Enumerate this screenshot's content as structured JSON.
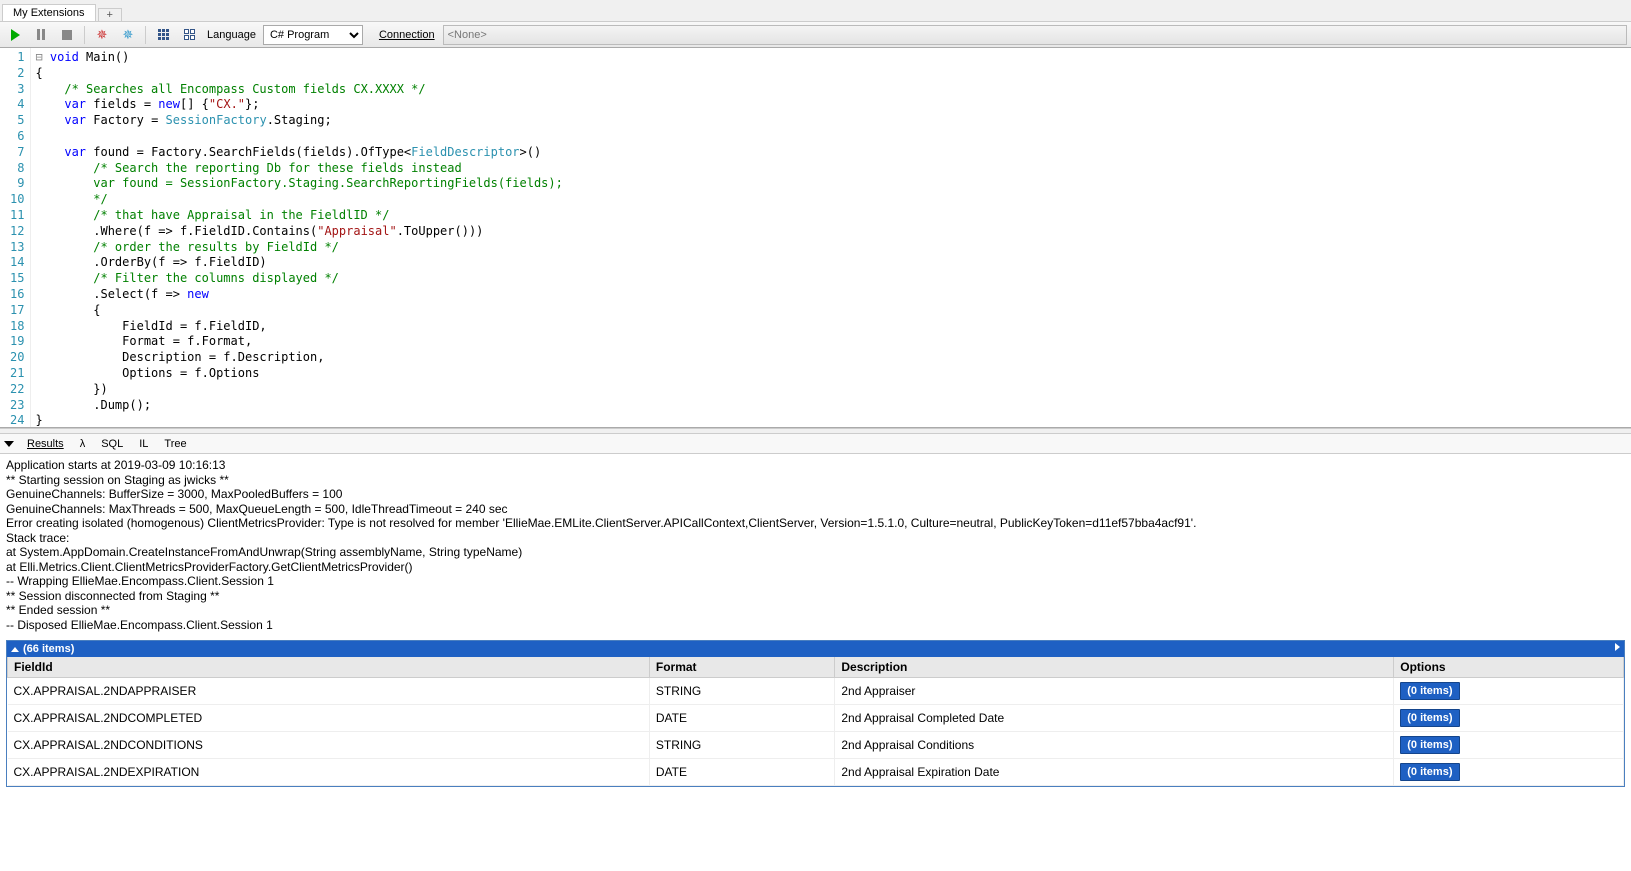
{
  "tabs": {
    "main": "My Extensions",
    "add": "+"
  },
  "toolbar": {
    "language_label": "Language",
    "language_value": "C# Program",
    "connection_label": "Connection",
    "connection_value": "<None>"
  },
  "code": {
    "lines": [
      "1",
      "2",
      "3",
      "4",
      "5",
      "6",
      "7",
      "8",
      "9",
      "10",
      "11",
      "12",
      "13",
      "14",
      "15",
      "16",
      "17",
      "18",
      "19",
      "20",
      "21",
      "22",
      "23",
      "24"
    ],
    "l1a": "void",
    "l1b": " Main()",
    "l2": "{",
    "l3a": "    ",
    "l3b": "/* Searches all Encompass Custom fields CX.XXXX */",
    "l4a": "    ",
    "l4b": "var",
    "l4c": " fields = ",
    "l4d": "new",
    "l4e": "[] {",
    "l4f": "\"CX.\"",
    "l4g": "};",
    "l5a": "    ",
    "l5b": "var",
    "l5c": " Factory = ",
    "l5d": "SessionFactory",
    "l5e": ".Staging;",
    "l6": "",
    "l7a": "    ",
    "l7b": "var",
    "l7c": " found = Factory.SearchFields(fields).OfType<",
    "l7d": "FieldDescriptor",
    "l7e": ">()",
    "l8a": "        ",
    "l8b": "/* Search the reporting Db for these fields instead",
    "l9": "        var found = SessionFactory.Staging.SearchReportingFields(fields);",
    "l10": "        */",
    "l11a": "        ",
    "l11b": "/* that have Appraisal in the FieldlID */",
    "l12a": "        .Where(f => f.FieldID.Contains(",
    "l12b": "\"Appraisal\"",
    "l12c": ".ToUpper()))",
    "l13a": "        ",
    "l13b": "/* order the results by FieldId */",
    "l14": "        .OrderBy(f => f.FieldID)",
    "l15a": "        ",
    "l15b": "/* Filter the columns displayed */",
    "l16a": "        .Select(f => ",
    "l16b": "new",
    "l17": "        {",
    "l18": "            FieldId = f.FieldID,",
    "l19": "            Format = f.Format,",
    "l20": "            Description = f.Description,",
    "l21": "            Options = f.Options",
    "l22": "        })",
    "l23": "        .Dump();",
    "l24": "}"
  },
  "result_tabs": {
    "results": "Results",
    "lambda": "λ",
    "sql": "SQL",
    "il": "IL",
    "tree": "Tree"
  },
  "output_lines": [
    "Application starts at 2019-03-09 10:16:13",
    "** Starting session on Staging as jwicks **",
    "GenuineChannels: BufferSize = 3000, MaxPooledBuffers = 100",
    "GenuineChannels: MaxThreads = 500, MaxQueueLength = 500, IdleThreadTimeout = 240 sec",
    "Error creating isolated (homogenous) ClientMetricsProvider: Type is not resolved for member 'EllieMae.EMLite.ClientServer.APICallContext,ClientServer, Version=1.5.1.0, Culture=neutral, PublicKeyToken=d11ef57bba4acf91'.",
    "Stack trace:",
    "   at System.AppDomain.CreateInstanceFromAndUnwrap(String assemblyName, String typeName)",
    "   at Elli.Metrics.Client.ClientMetricsProviderFactory.GetClientMetricsProvider()",
    " -- Wrapping EllieMae.Encompass.Client.Session 1",
    "** Session disconnected from Staging **",
    "** Ended session **",
    " -- Disposed EllieMae.Encompass.Client.Session 1"
  ],
  "grid": {
    "header": "(66 items)",
    "columns": [
      "FieldId",
      "Format",
      "Description",
      "Options"
    ],
    "badge": "(0 items)",
    "rows": [
      {
        "fieldId": "CX.APPRAISAL.2NDAPPRAISER",
        "format": "STRING",
        "description": "2nd Appraiser"
      },
      {
        "fieldId": "CX.APPRAISAL.2NDCOMPLETED",
        "format": "DATE",
        "description": "2nd Appraisal Completed Date"
      },
      {
        "fieldId": "CX.APPRAISAL.2NDCONDITIONS",
        "format": "STRING",
        "description": "2nd Appraisal Conditions"
      },
      {
        "fieldId": "CX.APPRAISAL.2NDEXPIRATION",
        "format": "DATE",
        "description": "2nd Appraisal Expiration Date"
      }
    ]
  }
}
